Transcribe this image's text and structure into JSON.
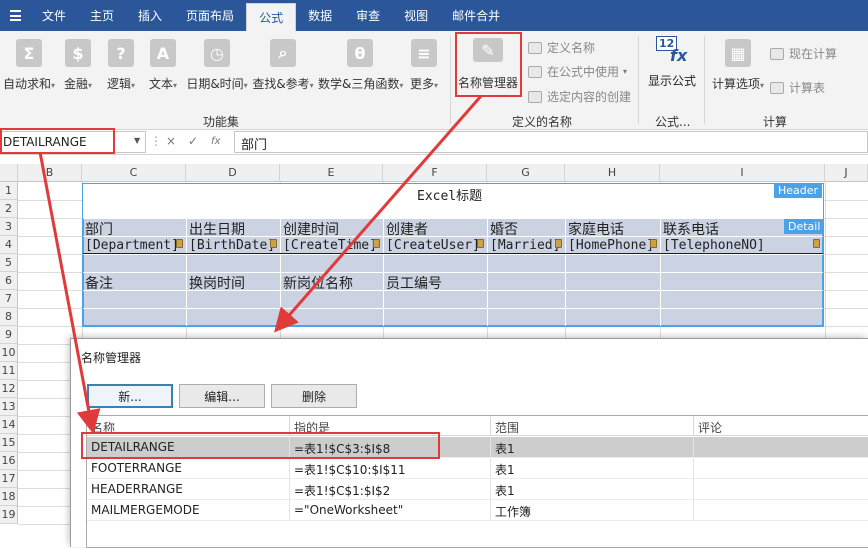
{
  "tabs": [
    "文件",
    "主页",
    "插入",
    "页面布局",
    "公式",
    "数据",
    "审查",
    "视图",
    "邮件合并"
  ],
  "active_tab": "公式",
  "ribbon": {
    "function_library": {
      "buttons": [
        {
          "label": "自动求和",
          "glyph": "Σ"
        },
        {
          "label": "金融",
          "glyph": "$"
        },
        {
          "label": "逻辑",
          "glyph": "?"
        },
        {
          "label": "文本",
          "glyph": "A"
        },
        {
          "label": "日期&时间",
          "glyph": "◷"
        },
        {
          "label": "查找&参考",
          "glyph": "⌕"
        },
        {
          "label": "数学&三角函数",
          "glyph": "θ"
        },
        {
          "label": "更多",
          "glyph": "≡"
        }
      ],
      "group_label": "功能集"
    },
    "defined_names": {
      "name_manager": "名称管理器",
      "define_name": "定义名称",
      "use_in_formula": "在公式中使用",
      "create_from_selection": "选定内容的创建",
      "group_label": "定义的名称"
    },
    "formula_auditing": {
      "show_formulas": "显示公式",
      "badge": "12",
      "group_label": "公式..."
    },
    "calculation": {
      "options": "计算选项",
      "calc_now": "现在计算",
      "calc_sheet": "计算表",
      "group_label": "计算"
    }
  },
  "formula_bar": {
    "name_box": "DETAILRANGE",
    "cancel": "×",
    "enter": "✓",
    "fx": "fx",
    "content": "部门"
  },
  "grid": {
    "columns": [
      "B",
      "C",
      "D",
      "E",
      "F",
      "G",
      "H",
      "I",
      "J"
    ],
    "rows": [
      "1",
      "2",
      "3",
      "4",
      "5",
      "6",
      "7",
      "8",
      "9",
      "10",
      "11",
      "12",
      "13",
      "14",
      "15",
      "16",
      "17",
      "18",
      "19"
    ],
    "title_cell": "Excel标题",
    "header_tag": "Header",
    "detail_tag": "Detail",
    "row3": [
      "部门",
      "出生日期",
      "创建时间",
      "创建者",
      "婚否",
      "家庭电话",
      "联系电话"
    ],
    "row4": [
      "[Department]",
      "[BirthDate]",
      "[CreateTime]",
      "[CreateUser]",
      "[Married]",
      "[HomePhone]",
      "[TelephoneNO]"
    ],
    "row6": [
      "备注",
      "换岗时间",
      "新岗位名称",
      "员工编号"
    ]
  },
  "dialog": {
    "title": "名称管理器",
    "buttons": {
      "new": "新...",
      "edit": "编辑...",
      "delete": "删除"
    },
    "columns": [
      "名称",
      "指的是",
      "范围",
      "评论"
    ],
    "rows": [
      {
        "name": "DETAILRANGE",
        "ref": "=表1!$C$3:$I$8",
        "scope": "表1",
        "comment": ""
      },
      {
        "name": "FOOTERRANGE",
        "ref": "=表1!$C$10:$I$11",
        "scope": "表1",
        "comment": ""
      },
      {
        "name": "HEADERRANGE",
        "ref": "=表1!$C$1:$I$2",
        "scope": "表1",
        "comment": ""
      },
      {
        "name": "MAILMERGEMODE",
        "ref": "=\"OneWorksheet\"",
        "scope": "工作簿",
        "comment": ""
      }
    ]
  },
  "colors": {
    "tab_bar": "#2b579a",
    "highlight": "#e03a3a",
    "region_fill": "#b9c3d8",
    "region_border": "#4aa2e8",
    "tag": "#4aa2e8"
  }
}
